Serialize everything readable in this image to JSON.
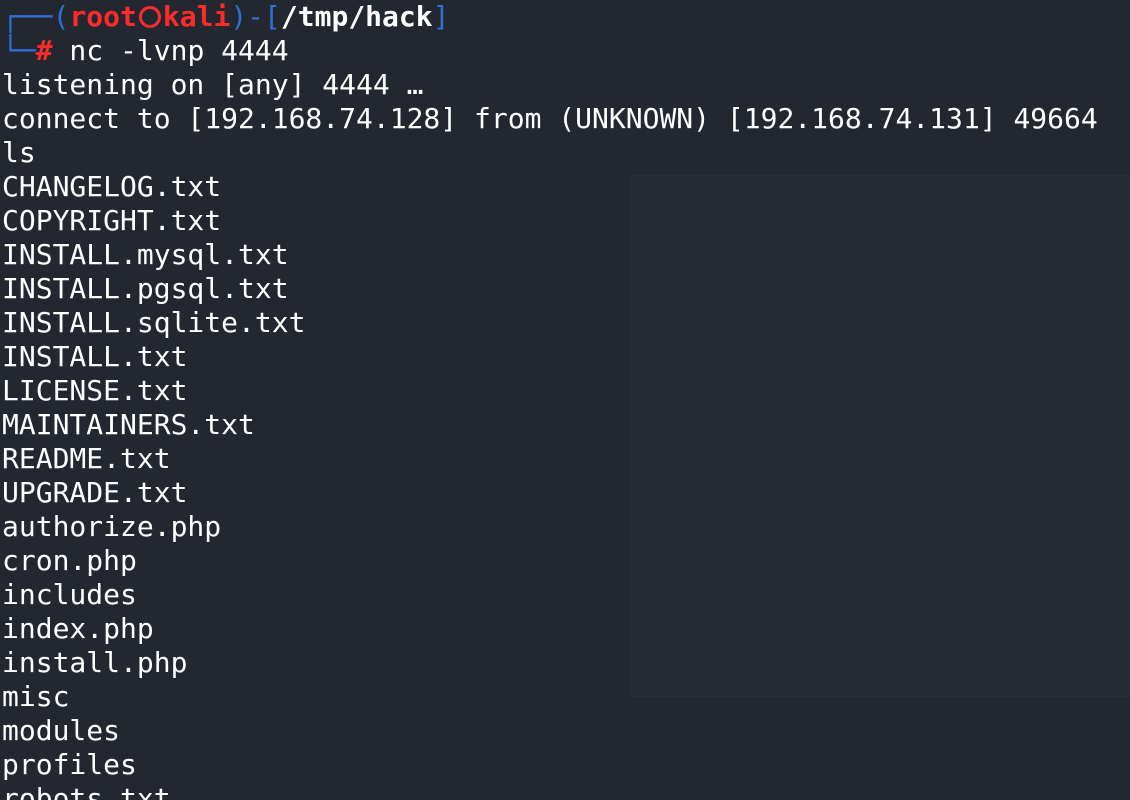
{
  "prompt": {
    "bracket_open": "┌──(",
    "user": "root",
    "host": "kali",
    "bracket_close": ")-[",
    "path": "/tmp/hack",
    "path_close": "]",
    "corner": "└─",
    "hash": "#",
    "command": " nc -lvnp 4444"
  },
  "output": [
    "listening on [any] 4444 …",
    "connect to [192.168.74.128] from (UNKNOWN) [192.168.74.131] 49664",
    "ls",
    "CHANGELOG.txt",
    "COPYRIGHT.txt",
    "INSTALL.mysql.txt",
    "INSTALL.pgsql.txt",
    "INSTALL.sqlite.txt",
    "INSTALL.txt",
    "LICENSE.txt",
    "MAINTAINERS.txt",
    "README.txt",
    "UPGRADE.txt",
    "authorize.php",
    "cron.php",
    "includes",
    "index.php",
    "install.php",
    "misc",
    "modules",
    "profiles",
    "robots.txt"
  ]
}
